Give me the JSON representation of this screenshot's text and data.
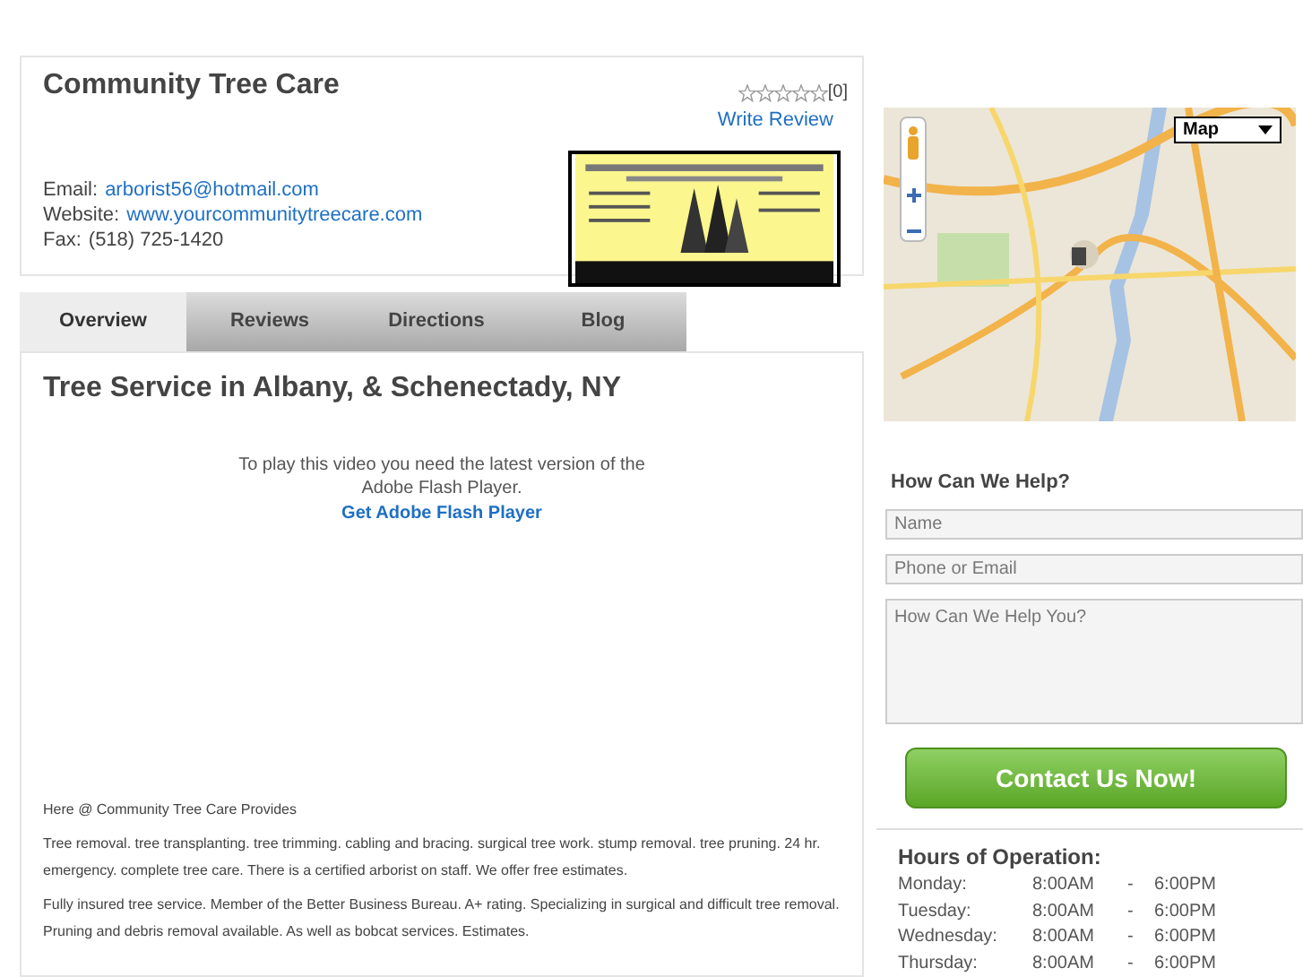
{
  "business": {
    "name": "Community Tree Care",
    "stars": 0,
    "review_count": "[0]",
    "write_review": "Write Review",
    "contact": [
      {
        "label": "Email:",
        "value": "arborist56@hotmail.com",
        "kind": "link"
      },
      {
        "label": "Website:",
        "value": "www.yourcommunitytreecare.com",
        "kind": "link"
      },
      {
        "label": "Fax:",
        "value": "(518) 725-1420",
        "kind": "text"
      }
    ]
  },
  "tabs": [
    {
      "label": "Overview",
      "selected": true
    },
    {
      "label": "Reviews",
      "selected": false
    },
    {
      "label": "Directions",
      "selected": false
    },
    {
      "label": "Blog",
      "selected": false
    }
  ],
  "content": {
    "heading": "Tree Service in Albany, & Schenectady, NY",
    "flash_message": "To play this video you need the latest version of the Adobe Flash Player.",
    "flash_link": "Get Adobe Flash Player",
    "paragraphs": [
      "Here @ Community Tree Care Provides",
      "Tree removal. tree transplanting. tree trimming. cabling and bracing. surgical tree work. stump removal. tree pruning. 24 hr. emergency. complete tree care. There is a certified arborist on staff. We offer free estimates.",
      "Fully insured tree service. Member of the Better Business Bureau. A+ rating. Specializing in surgical and difficult tree removal. Pruning and debris removal available. As well as bobcat services. Estimates."
    ]
  },
  "map": {
    "map_type": "Map"
  },
  "contact_form": {
    "title": "How Can We Help?",
    "fields": [
      {
        "placeholder": "Name",
        "kind": "input"
      },
      {
        "placeholder": "Phone or Email",
        "kind": "input"
      },
      {
        "placeholder": "How Can We Help You?",
        "kind": "textarea"
      }
    ],
    "submit": "Contact Us Now!"
  },
  "hours": {
    "title": "Hours of Operation:",
    "rows": [
      {
        "day": "Monday:",
        "open": "8:00AM",
        "dash": "-",
        "close": "6:00PM"
      },
      {
        "day": "Tuesday:",
        "open": "8:00AM",
        "dash": "-",
        "close": "6:00PM"
      },
      {
        "day": "Wednesday:",
        "open": "8:00AM",
        "dash": "-",
        "close": "6:00PM"
      },
      {
        "day": "Thursday:",
        "open": "8:00AM",
        "dash": "-",
        "close": "6:00PM"
      }
    ]
  }
}
